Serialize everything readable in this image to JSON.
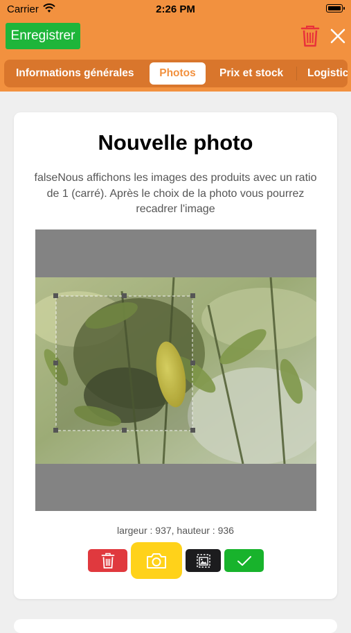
{
  "status_bar": {
    "carrier": "Carrier",
    "time": "2:26 PM"
  },
  "toolbar": {
    "save_label": "Enregistrer",
    "delete_icon": "trash-icon",
    "close_icon": "close-icon"
  },
  "tabs": [
    {
      "label": "Informations générales",
      "active": false
    },
    {
      "label": "Photos",
      "active": true
    },
    {
      "label": "Prix et stock",
      "active": false
    },
    {
      "label": "Logistic",
      "active": false
    }
  ],
  "photo_card": {
    "title": "Nouvelle photo",
    "description": "falseNous affichons les images des produits avec un ratio de 1 (carré). Après le choix de la photo vous pourrez recadrer l'image",
    "dimensions": "largeur : 937, hauteur : 936"
  },
  "actions": {
    "delete_icon": "trash-icon",
    "camera_icon": "camera-icon",
    "gallery_icon": "image-crop-icon",
    "confirm_icon": "checkmark-icon"
  },
  "colors": {
    "header": "#f2913f",
    "tab_bar": "#d9762c",
    "save_button": "#1eb53a",
    "delete": "#e0393e",
    "camera": "#ffd21a",
    "gallery": "#1c1c1e",
    "confirm": "#18b32c"
  }
}
